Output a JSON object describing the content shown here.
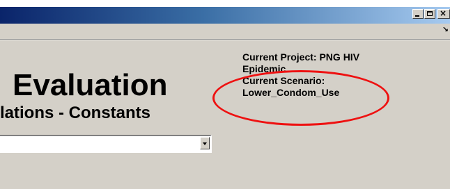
{
  "window": {
    "minimize_label": "_",
    "maximize_label": "□",
    "close_label": "×",
    "menu_glyph": "↘",
    "titlebar_gradient": [
      "#0a246a",
      "#3a6ea5",
      "#a6caf0"
    ],
    "background_color": "#d4d0c8"
  },
  "header": {
    "title": "Evaluation",
    "subtitle": "lations - Constants"
  },
  "project_info": {
    "project_line1": "Current Project: PNG HIV",
    "project_line2": "Epidemic",
    "scenario_label": "Current Scenario:",
    "scenario_value": "Lower_Condom_Use",
    "highlight_color": "#ee1111"
  },
  "combo": {
    "value": ""
  },
  "icons": {
    "minimize": "minimize-icon",
    "maximize": "maximize-icon",
    "close": "close-icon",
    "dropdown": "chevron-down-icon"
  }
}
